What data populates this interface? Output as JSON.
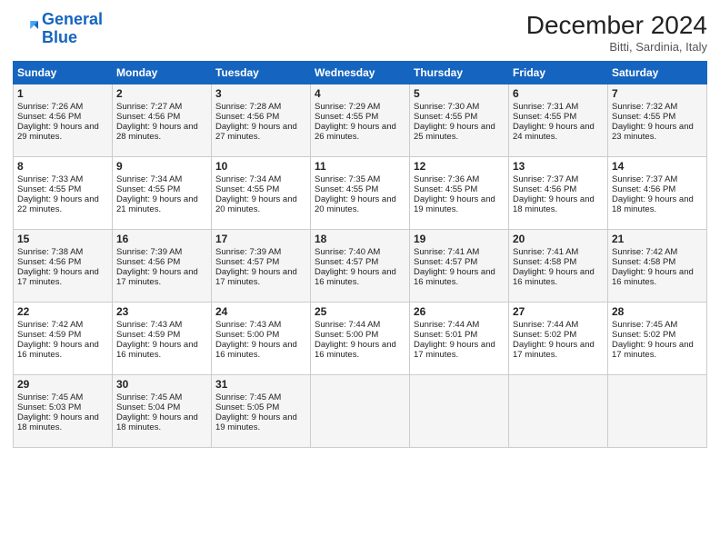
{
  "logo": {
    "line1": "General",
    "line2": "Blue"
  },
  "title": "December 2024",
  "location": "Bitti, Sardinia, Italy",
  "days_of_week": [
    "Sunday",
    "Monday",
    "Tuesday",
    "Wednesday",
    "Thursday",
    "Friday",
    "Saturday"
  ],
  "weeks": [
    [
      {
        "day": 1,
        "sunrise": "7:26 AM",
        "sunset": "4:56 PM",
        "daylight": "9 hours and 29 minutes."
      },
      {
        "day": 2,
        "sunrise": "7:27 AM",
        "sunset": "4:56 PM",
        "daylight": "9 hours and 28 minutes."
      },
      {
        "day": 3,
        "sunrise": "7:28 AM",
        "sunset": "4:56 PM",
        "daylight": "9 hours and 27 minutes."
      },
      {
        "day": 4,
        "sunrise": "7:29 AM",
        "sunset": "4:55 PM",
        "daylight": "9 hours and 26 minutes."
      },
      {
        "day": 5,
        "sunrise": "7:30 AM",
        "sunset": "4:55 PM",
        "daylight": "9 hours and 25 minutes."
      },
      {
        "day": 6,
        "sunrise": "7:31 AM",
        "sunset": "4:55 PM",
        "daylight": "9 hours and 24 minutes."
      },
      {
        "day": 7,
        "sunrise": "7:32 AM",
        "sunset": "4:55 PM",
        "daylight": "9 hours and 23 minutes."
      }
    ],
    [
      {
        "day": 8,
        "sunrise": "7:33 AM",
        "sunset": "4:55 PM",
        "daylight": "9 hours and 22 minutes."
      },
      {
        "day": 9,
        "sunrise": "7:34 AM",
        "sunset": "4:55 PM",
        "daylight": "9 hours and 21 minutes."
      },
      {
        "day": 10,
        "sunrise": "7:34 AM",
        "sunset": "4:55 PM",
        "daylight": "9 hours and 20 minutes."
      },
      {
        "day": 11,
        "sunrise": "7:35 AM",
        "sunset": "4:55 PM",
        "daylight": "9 hours and 20 minutes."
      },
      {
        "day": 12,
        "sunrise": "7:36 AM",
        "sunset": "4:55 PM",
        "daylight": "9 hours and 19 minutes."
      },
      {
        "day": 13,
        "sunrise": "7:37 AM",
        "sunset": "4:56 PM",
        "daylight": "9 hours and 18 minutes."
      },
      {
        "day": 14,
        "sunrise": "7:37 AM",
        "sunset": "4:56 PM",
        "daylight": "9 hours and 18 minutes."
      }
    ],
    [
      {
        "day": 15,
        "sunrise": "7:38 AM",
        "sunset": "4:56 PM",
        "daylight": "9 hours and 17 minutes."
      },
      {
        "day": 16,
        "sunrise": "7:39 AM",
        "sunset": "4:56 PM",
        "daylight": "9 hours and 17 minutes."
      },
      {
        "day": 17,
        "sunrise": "7:39 AM",
        "sunset": "4:57 PM",
        "daylight": "9 hours and 17 minutes."
      },
      {
        "day": 18,
        "sunrise": "7:40 AM",
        "sunset": "4:57 PM",
        "daylight": "9 hours and 16 minutes."
      },
      {
        "day": 19,
        "sunrise": "7:41 AM",
        "sunset": "4:57 PM",
        "daylight": "9 hours and 16 minutes."
      },
      {
        "day": 20,
        "sunrise": "7:41 AM",
        "sunset": "4:58 PM",
        "daylight": "9 hours and 16 minutes."
      },
      {
        "day": 21,
        "sunrise": "7:42 AM",
        "sunset": "4:58 PM",
        "daylight": "9 hours and 16 minutes."
      }
    ],
    [
      {
        "day": 22,
        "sunrise": "7:42 AM",
        "sunset": "4:59 PM",
        "daylight": "9 hours and 16 minutes."
      },
      {
        "day": 23,
        "sunrise": "7:43 AM",
        "sunset": "4:59 PM",
        "daylight": "9 hours and 16 minutes."
      },
      {
        "day": 24,
        "sunrise": "7:43 AM",
        "sunset": "5:00 PM",
        "daylight": "9 hours and 16 minutes."
      },
      {
        "day": 25,
        "sunrise": "7:44 AM",
        "sunset": "5:00 PM",
        "daylight": "9 hours and 16 minutes."
      },
      {
        "day": 26,
        "sunrise": "7:44 AM",
        "sunset": "5:01 PM",
        "daylight": "9 hours and 17 minutes."
      },
      {
        "day": 27,
        "sunrise": "7:44 AM",
        "sunset": "5:02 PM",
        "daylight": "9 hours and 17 minutes."
      },
      {
        "day": 28,
        "sunrise": "7:45 AM",
        "sunset": "5:02 PM",
        "daylight": "9 hours and 17 minutes."
      }
    ],
    [
      {
        "day": 29,
        "sunrise": "7:45 AM",
        "sunset": "5:03 PM",
        "daylight": "9 hours and 18 minutes."
      },
      {
        "day": 30,
        "sunrise": "7:45 AM",
        "sunset": "5:04 PM",
        "daylight": "9 hours and 18 minutes."
      },
      {
        "day": 31,
        "sunrise": "7:45 AM",
        "sunset": "5:05 PM",
        "daylight": "9 hours and 19 minutes."
      },
      null,
      null,
      null,
      null
    ]
  ]
}
